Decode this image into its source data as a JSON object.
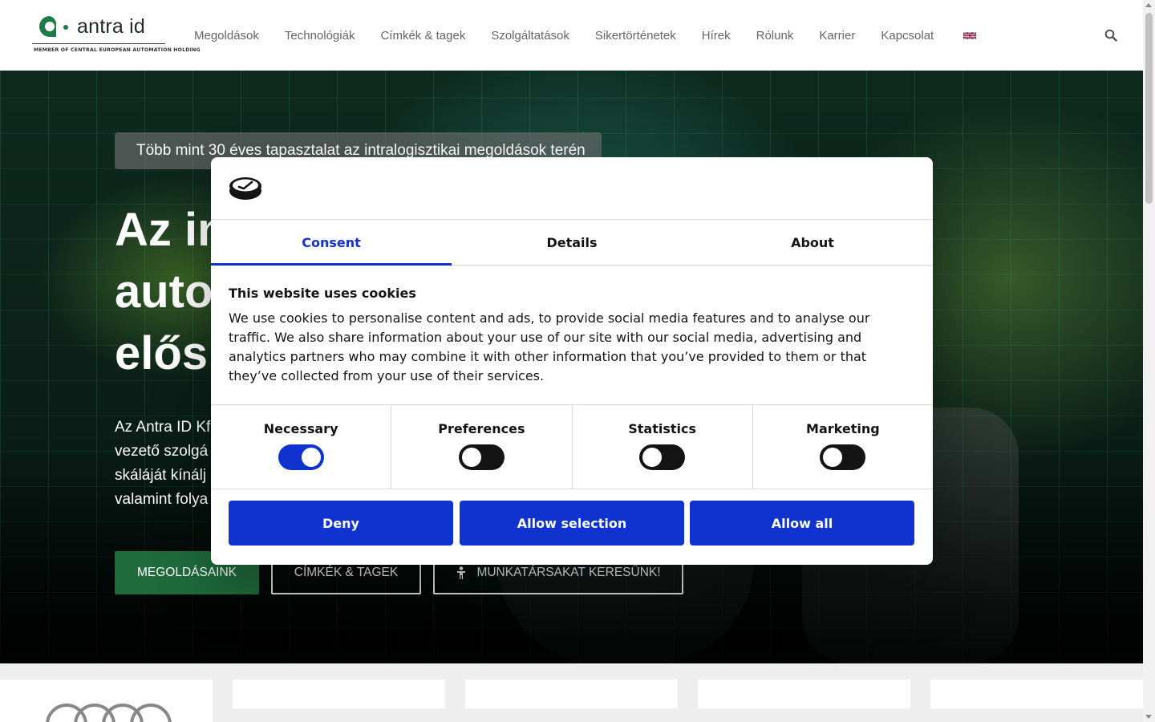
{
  "header": {
    "logo_text": "antra id",
    "logo_tagline": "MEMBER OF CENTRAL EUROPEAN AUTOMATION HOLDING",
    "nav": [
      "Megoldások",
      "Technológiák",
      "Címkék & tagek",
      "Szolgáltatások",
      "Sikertörténetek",
      "Hírek",
      "Rólunk",
      "Karrier",
      "Kapcsolat"
    ],
    "language_icon": "uk-flag-icon",
    "search_icon": "search-icon"
  },
  "hero": {
    "badge": "Több mint 30 éves tapasztalat az intralogisztikai megoldások terén",
    "title_lines": [
      "Az in",
      "auto",
      "elős"
    ],
    "text_lines": [
      "Az Antra ID Kf",
      "vezető szolgá",
      "skáláját kínálj",
      "valamint folya"
    ],
    "buttons": {
      "solutions": "MEGOLDÁSAINK",
      "tags": "CÍMKÉK & TAGEK",
      "careers": "MUNKATÁRSAKAT KERESÜNK!"
    }
  },
  "cookie_dialog": {
    "tabs": [
      "Consent",
      "Details",
      "About"
    ],
    "active_tab": "Consent",
    "heading": "This website uses cookies",
    "body": "We use cookies to personalise content and ads, to provide social media features and to analyse our traffic. We also share information about your use of our site with our social media, advertising and analytics partners who may combine it with other information that you’ve provided to them or that they’ve collected from your use of their services.",
    "toggles": [
      {
        "label": "Necessary",
        "checked": true
      },
      {
        "label": "Preferences",
        "checked": false
      },
      {
        "label": "Statistics",
        "checked": false
      },
      {
        "label": "Marketing",
        "checked": false
      }
    ],
    "buttons": {
      "deny": "Deny",
      "allow_selection": "Allow selection",
      "allow_all": "Allow all"
    }
  },
  "colors": {
    "brand_green": "#1f6b3b",
    "cookiebot_blue": "#1032cf",
    "logo_green": "#1f7a45"
  }
}
